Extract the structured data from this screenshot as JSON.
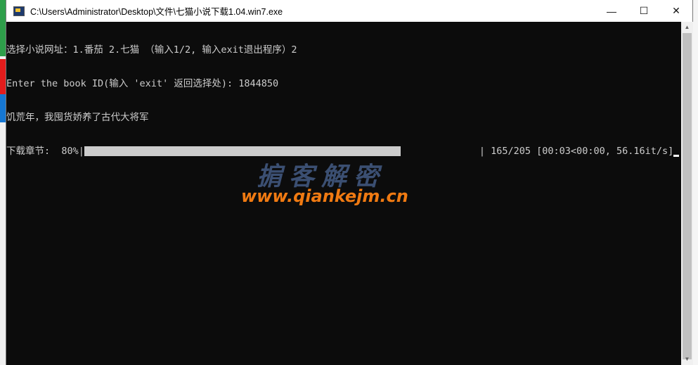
{
  "window": {
    "title": "C:\\Users\\Administrator\\Desktop\\文件\\七猫小说下载1.04.win7.exe",
    "minimize": "—",
    "maximize": "☐",
    "close": "✕"
  },
  "console": {
    "lines": [
      "选择小说网址：1.番茄 2.七猫 （输入1/2, 输入exit退出程序）2",
      "Enter the book ID(输入 'exit' 返回选择处): 1844850",
      "饥荒年，我囤货娇养了古代大将军"
    ],
    "progress_label": "下载章节:  80%|",
    "progress_percent": 80,
    "progress_stats": "| 165/205 [00:03<00:00, 56.16it/s]"
  },
  "watermark": {
    "title": "掮客解密",
    "url": "www.qiankejm.cn"
  }
}
